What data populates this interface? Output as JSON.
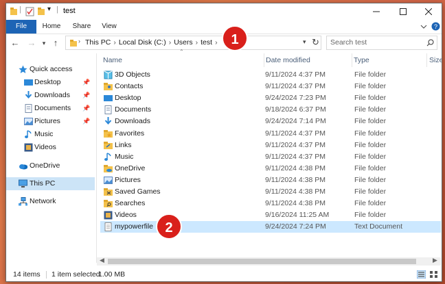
{
  "window": {
    "title": "test"
  },
  "ribbon": {
    "tabs": [
      "File",
      "Home",
      "Share",
      "View"
    ]
  },
  "address": {
    "crumbs": [
      "This PC",
      "Local Disk (C:)",
      "Users",
      "test"
    ],
    "search_placeholder": "Search test"
  },
  "nav": {
    "quick_access": "Quick access",
    "quick_items": [
      "Desktop",
      "Downloads",
      "Documents",
      "Pictures",
      "Music",
      "Videos"
    ],
    "onedrive": "OneDrive",
    "thispc": "This PC",
    "network": "Network"
  },
  "columns": {
    "name": "Name",
    "date": "Date modified",
    "type": "Type",
    "size": "Size"
  },
  "files": [
    {
      "name": "3D Objects",
      "date": "9/11/2024 4:37 PM",
      "type": "File folder",
      "icon": "3d-objects-icon"
    },
    {
      "name": "Contacts",
      "date": "9/11/2024 4:37 PM",
      "type": "File folder",
      "icon": "contacts-icon"
    },
    {
      "name": "Desktop",
      "date": "9/24/2024 7:23 PM",
      "type": "File folder",
      "icon": "desktop-icon"
    },
    {
      "name": "Documents",
      "date": "9/18/2024 6:37 PM",
      "type": "File folder",
      "icon": "documents-icon"
    },
    {
      "name": "Downloads",
      "date": "9/24/2024 7:14 PM",
      "type": "File folder",
      "icon": "downloads-icon"
    },
    {
      "name": "Favorites",
      "date": "9/11/2024 4:37 PM",
      "type": "File folder",
      "icon": "favorites-icon"
    },
    {
      "name": "Links",
      "date": "9/11/2024 4:37 PM",
      "type": "File folder",
      "icon": "links-icon"
    },
    {
      "name": "Music",
      "date": "9/11/2024 4:37 PM",
      "type": "File folder",
      "icon": "music-icon"
    },
    {
      "name": "OneDrive",
      "date": "9/11/2024 4:38 PM",
      "type": "File folder",
      "icon": "onedrive-icon"
    },
    {
      "name": "Pictures",
      "date": "9/11/2024 4:38 PM",
      "type": "File folder",
      "icon": "pictures-icon"
    },
    {
      "name": "Saved Games",
      "date": "9/11/2024 4:38 PM",
      "type": "File folder",
      "icon": "saved-games-icon"
    },
    {
      "name": "Searches",
      "date": "9/11/2024 4:38 PM",
      "type": "File folder",
      "icon": "searches-icon"
    },
    {
      "name": "Videos",
      "date": "9/16/2024 11:25 AM",
      "type": "File folder",
      "icon": "videos-icon"
    },
    {
      "name": "mypowerfile",
      "date": "9/24/2024 7:24 PM",
      "type": "Text Document",
      "icon": "text-document-icon"
    }
  ],
  "selected_row": "mypowerfile",
  "status": {
    "count": "14 items",
    "selected": "1 item selected",
    "size": "1.00 MB"
  },
  "badges": [
    "1",
    "2"
  ],
  "colors": {
    "accent": "#1d64b5",
    "selection": "#cce8ff",
    "badge": "#d9201b"
  }
}
